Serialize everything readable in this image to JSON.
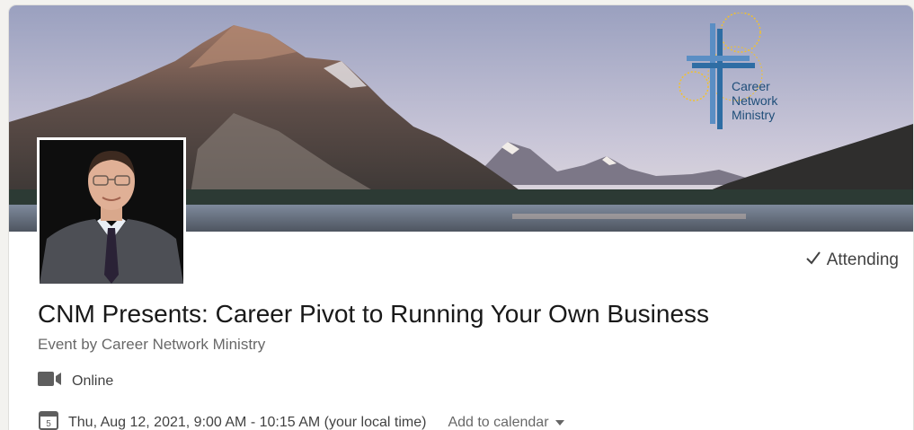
{
  "event": {
    "attending_label": "Attending",
    "title": "CNM Presents: Career Pivot to Running Your Own Business",
    "organizer_prefix": "Event by",
    "organizer_name": "Career Network Ministry",
    "format": "Online",
    "datetime": "Thu, Aug 12, 2021, 9:00 AM - 10:15 AM (your local time)",
    "add_to_calendar": "Add to calendar",
    "calendar_day": "5"
  },
  "banner": {
    "logo_lines": [
      "Career",
      "Network",
      "Ministry"
    ]
  },
  "icons": {
    "attending": "checkmark-icon",
    "online": "video-camera-icon",
    "date": "calendar-icon",
    "dropdown": "caret-down-icon"
  },
  "colors": {
    "logo_blue": "#2e6da4",
    "logo_gold": "#f2c12e",
    "text_primary": "#000000e6",
    "text_secondary": "#00000099"
  }
}
